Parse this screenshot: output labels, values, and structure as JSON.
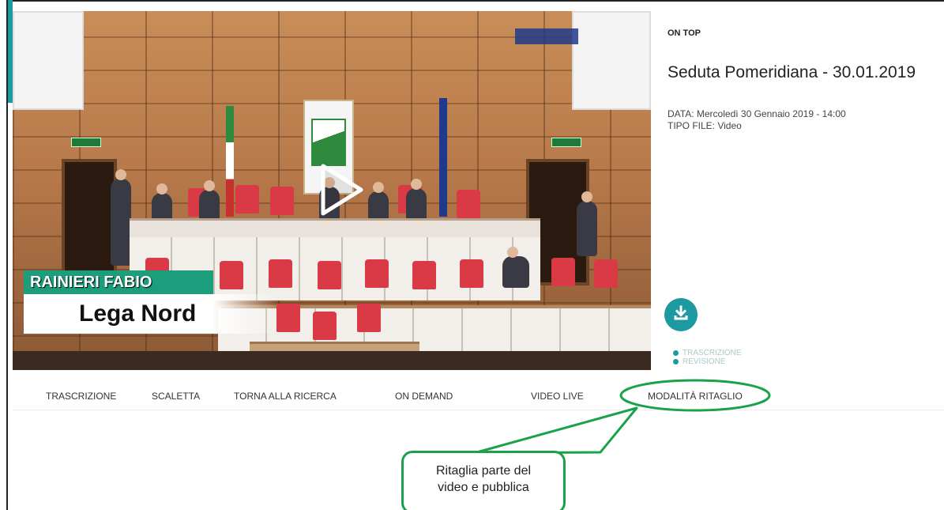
{
  "player": {
    "caption_name": "RAINIERI FABIO",
    "caption_party": "Lega Nord",
    "play_icon": "play-icon"
  },
  "details": {
    "label": "ON TOP",
    "title": "Seduta Pomeridiana - 30.01.2019",
    "date": "DATA: Mercoledì 30 Gennaio 2019 - 14:00",
    "file_type": "TIPO FILE: Video",
    "download_icon": "download-icon",
    "legend": [
      "TRASCRIZIONE",
      "REVISIONE"
    ]
  },
  "tabs": [
    "TRASCRIZIONE",
    "SCALETTA",
    "TORNA ALLA RICERCA",
    "ON DEMAND",
    "VIDEO LIVE",
    "MODALITÀ RITAGLIO"
  ],
  "annotation": {
    "text_line1": "Ritaglia parte del",
    "text_line2": "video e pubblica"
  },
  "colors": {
    "accent": "#1c9aa0",
    "highlight": "#1aa24a",
    "caption": "#1c9e7c"
  }
}
